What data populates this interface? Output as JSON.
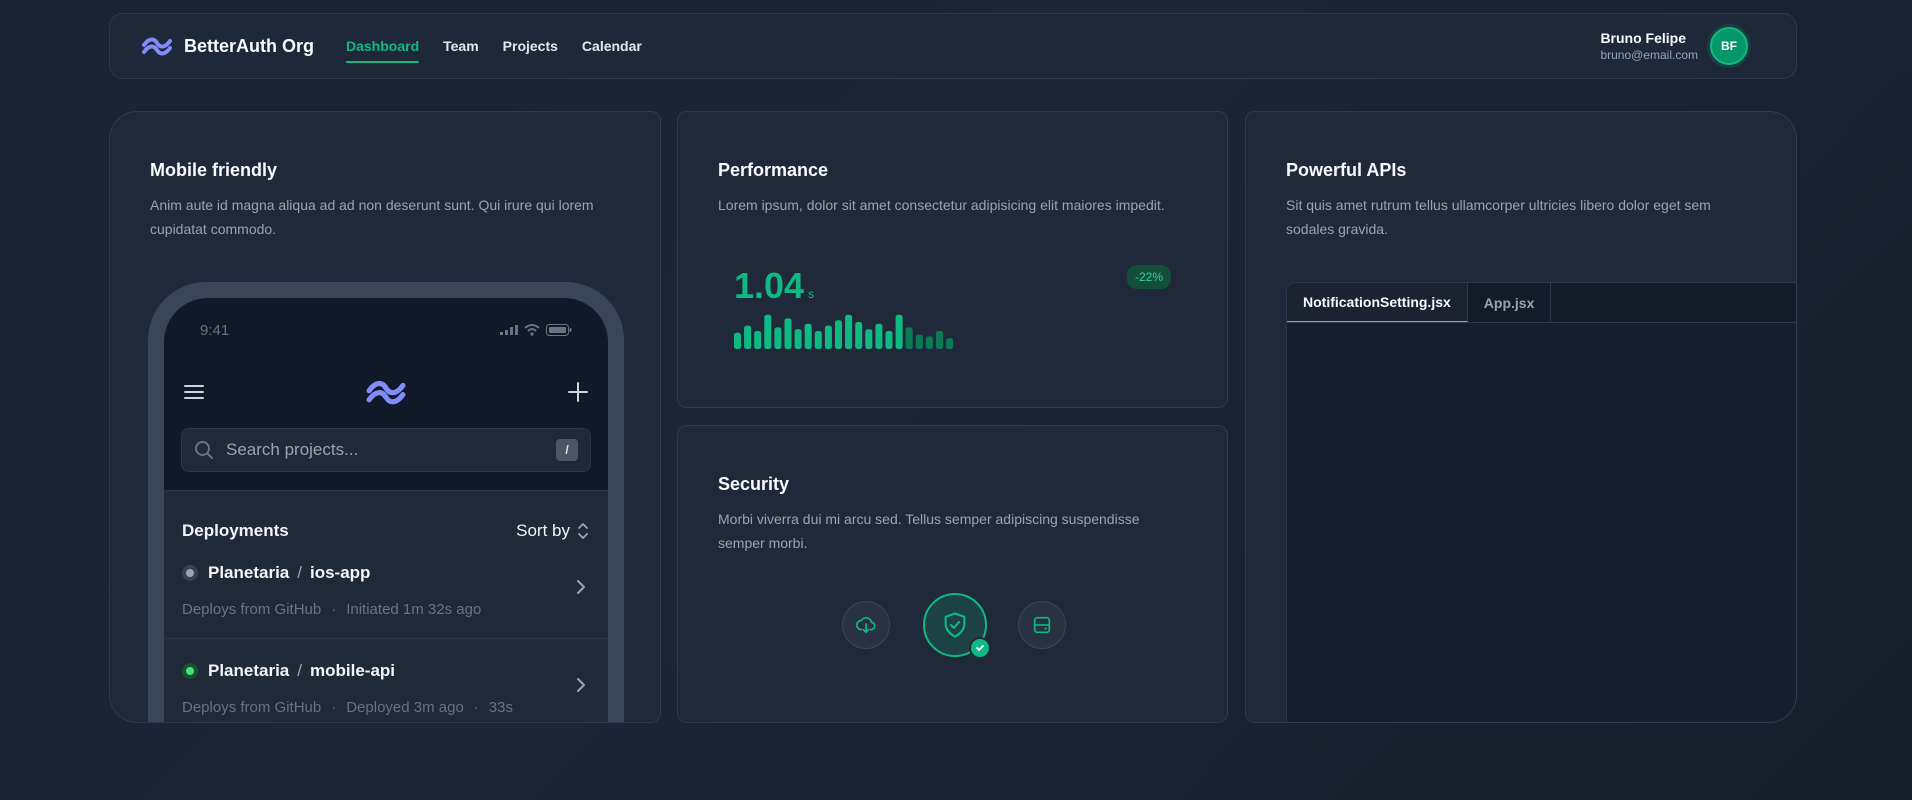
{
  "navbar": {
    "brand": "BetterAuth Org",
    "links": [
      {
        "label": "Dashboard",
        "active": true
      },
      {
        "label": "Team"
      },
      {
        "label": "Projects"
      },
      {
        "label": "Calendar"
      }
    ],
    "user": {
      "name": "Bruno Felipe",
      "email": "bruno@email.com",
      "initials": "BF"
    }
  },
  "mobile_card": {
    "title": "Mobile friendly",
    "description": "Anim aute id magna aliqua ad ad non deserunt sunt. Qui irure qui lorem cupidatat commodo.",
    "phone": {
      "time": "9:41",
      "search_placeholder": "Search projects...",
      "search_shortcut": "/",
      "deployments_title": "Deployments",
      "sort_label": "Sort by",
      "deployments": [
        {
          "org": "Planetaria",
          "repo": "ios-app",
          "source": "Deploys from GitHub",
          "status": "Initiated 1m 32s ago",
          "state": "gray"
        },
        {
          "org": "Planetaria",
          "repo": "mobile-api",
          "source": "Deploys from GitHub",
          "status": "Deployed 3m ago",
          "extra": "33s",
          "state": "green"
        }
      ]
    }
  },
  "performance_card": {
    "title": "Performance",
    "description": "Lorem ipsum, dolor sit amet consectetur adipisicing elit maiores impedit.",
    "value": "1.04",
    "unit": "s",
    "change": "-22%",
    "bars": [
      0.45,
      0.65,
      0.5,
      0.95,
      0.6,
      0.85,
      0.55,
      0.7,
      0.5,
      0.65,
      0.8,
      0.95,
      0.75,
      0.55,
      0.7,
      0.5,
      0.95,
      0.6,
      0.4,
      0.35,
      0.5,
      0.3
    ]
  },
  "security_card": {
    "title": "Security",
    "description": "Morbi viverra dui mi arcu sed. Tellus semper adipiscing suspendisse semper morbi."
  },
  "api_card": {
    "title": "Powerful APIs",
    "description": "Sit quis amet rutrum tellus ullamcorper ultricies libero dolor eget sem sodales gravida.",
    "tabs": [
      {
        "label": "NotificationSetting.jsx",
        "active": true
      },
      {
        "label": "App.jsx"
      }
    ]
  },
  "colors": {
    "accent": "#10b981",
    "bar_dim": "#0b7a57"
  }
}
